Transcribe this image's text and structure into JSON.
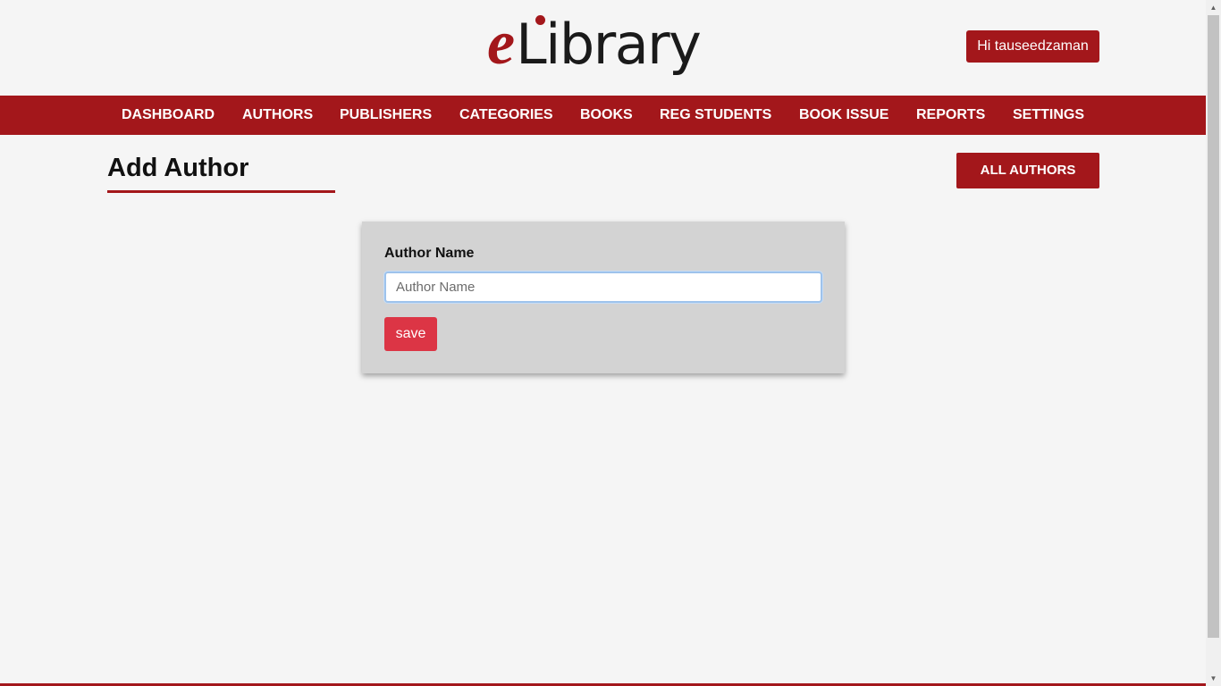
{
  "logo": {
    "e": "e",
    "rest": "Library"
  },
  "user": {
    "greeting": "Hi tauseedzaman"
  },
  "nav": {
    "items": [
      {
        "label": "DASHBOARD"
      },
      {
        "label": "AUTHORS"
      },
      {
        "label": "PUBLISHERS"
      },
      {
        "label": "CATEGORIES"
      },
      {
        "label": "BOOKS"
      },
      {
        "label": "REG STUDENTS"
      },
      {
        "label": "BOOK ISSUE"
      },
      {
        "label": "REPORTS"
      },
      {
        "label": "SETTINGS"
      }
    ]
  },
  "page": {
    "title": "Add Author",
    "all_authors_label": "ALL AUTHORS"
  },
  "form": {
    "label": "Author Name",
    "input_value": "",
    "input_placeholder": "Author Name",
    "save_label": "save"
  },
  "colors": {
    "brand": "#a3171b",
    "save_button": "#dc3545",
    "card": "#d3d3d3",
    "background": "#f5f5f5"
  },
  "icons": {
    "scroll_up": "scroll-up-arrow-icon",
    "scroll_down": "scroll-down-arrow-icon"
  }
}
